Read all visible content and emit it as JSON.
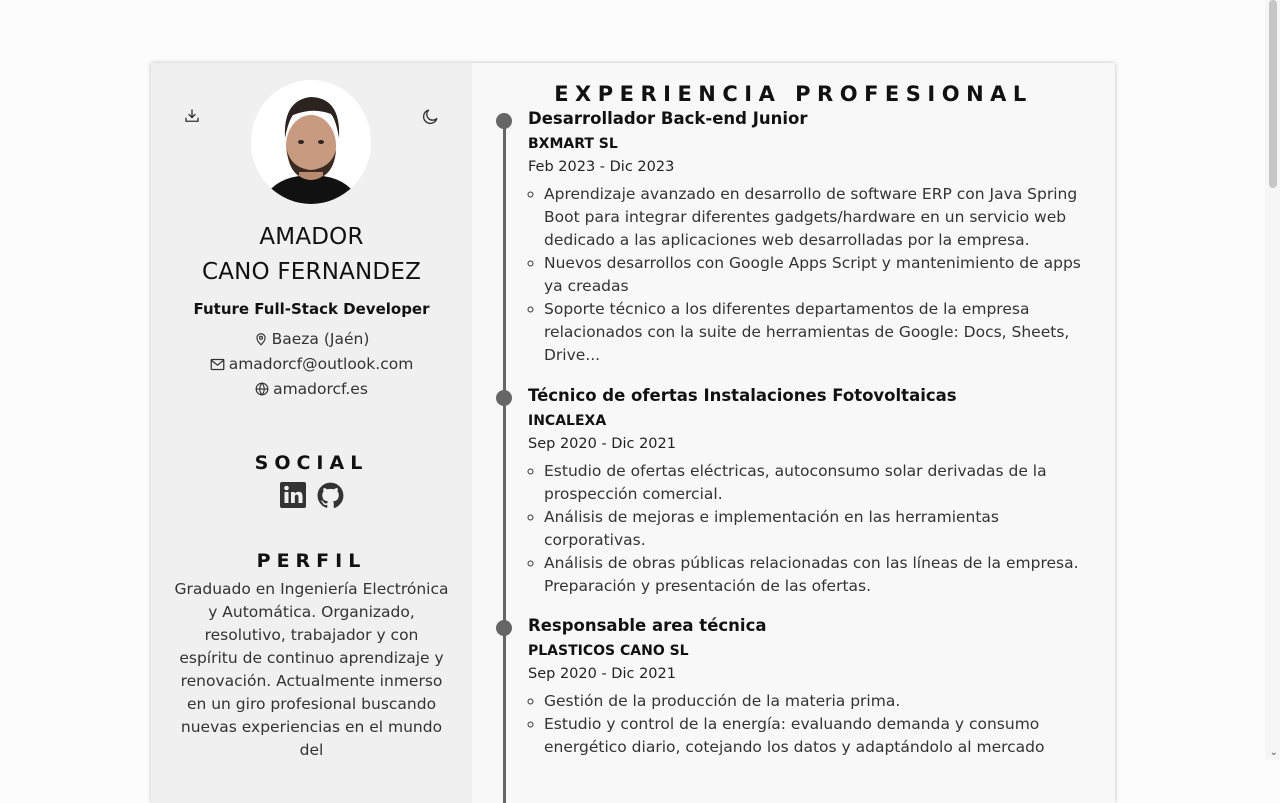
{
  "header": {
    "download_icon": "download-icon",
    "theme_icon": "moon-icon"
  },
  "profile": {
    "name_line1": "AMADOR",
    "name_line2": "CANO FERNANDEZ",
    "role": "Future Full-Stack Developer",
    "location": "Baeza (Jaén)",
    "email": "amadorcf@outlook.com",
    "website": "amadorcf.es"
  },
  "social": {
    "heading": "SOCIAL",
    "icons": [
      "linkedin-icon",
      "github-icon"
    ]
  },
  "perfil": {
    "heading": "PERFIL",
    "text": "Graduado en Ingeniería Electrónica y Automática. Organizado, resolutivo, trabajador y con espíritu de continuo aprendizaje y renovación. Actualmente inmerso en un giro profesional buscando nuevas experiencias en el mundo del"
  },
  "experience": {
    "heading": "EXPERIENCIA PROFESIONAL",
    "jobs": [
      {
        "title": "Desarrollador Back-end Junior",
        "company": "BXMART SL",
        "dates": "Feb 2023 - Dic 2023",
        "tasks": [
          "Aprendizaje avanzado en desarrollo de software ERP con Java Spring Boot para integrar diferentes gadgets/hardware en un servicio web dedicado a las aplicaciones web desarrolladas por la empresa.",
          "Nuevos desarrollos con Google Apps Script y mantenimiento de apps ya creadas",
          "Soporte técnico a los diferentes departamentos de la empresa relacionados con la suite de herramientas de Google: Docs, Sheets, Drive..."
        ]
      },
      {
        "title": "Técnico de ofertas Instalaciones Fotovoltaicas",
        "company": "INCALEXA",
        "dates": "Sep 2020 - Dic 2021",
        "tasks": [
          "Estudio de ofertas eléctricas, autoconsumo solar derivadas de la prospección comercial.",
          "Análisis de mejoras e implementación en las herramientas corporativas.",
          "Análisis de obras públicas relacionadas con las líneas de la empresa. Preparación y presentación de las ofertas."
        ]
      },
      {
        "title": "Responsable area técnica",
        "company": "PLASTICOS CANO SL",
        "dates": "Sep 2020 - Dic 2021",
        "tasks": [
          "Gestión de la producción de la materia prima.",
          "Estudio y control de la energía: evaluando demanda y consumo energético diario, cotejando los datos y adaptándolo al mercado"
        ]
      }
    ]
  },
  "colors": {
    "sidebar_bg": "#f0f0f0",
    "main_bg": "#f8f8f8",
    "timeline": "#666666",
    "text": "#333333"
  }
}
